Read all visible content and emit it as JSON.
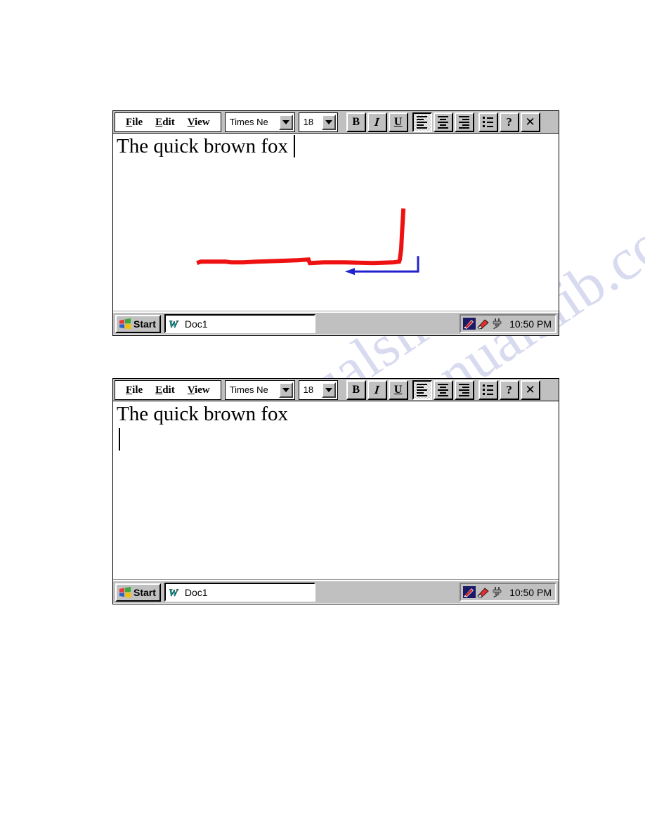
{
  "page": {
    "watermark_lines": [
      "manualslib.com",
      "manualslib.com"
    ]
  },
  "shared": {
    "menu": [
      {
        "accel": "F",
        "rest": "ile",
        "name": "file"
      },
      {
        "accel": "E",
        "rest": "dit",
        "name": "edit"
      },
      {
        "accel": "V",
        "rest": "iew",
        "name": "view"
      }
    ],
    "font_combo": {
      "value": "Times Ne",
      "options": [
        "Times Ne"
      ]
    },
    "size_combo": {
      "value": "18",
      "options": [
        "18"
      ]
    },
    "buttons": {
      "bold": "B",
      "italic": "I",
      "underline": "U",
      "align_left": "align-left-icon",
      "align_center": "align-center-icon",
      "align_right": "align-right-icon",
      "bullets": "bullet-list-icon",
      "help": "?",
      "close": "✕"
    },
    "taskbar": {
      "start_label": "Start",
      "task_label": "Doc1",
      "task_icon": "word-w-icon",
      "tray_icons": [
        "pen-input-panel-icon",
        "volume-speaker-icon",
        "power-plug-icon"
      ],
      "clock": "10:50 PM"
    }
  },
  "window_1": {
    "document_text": "The quick brown fox",
    "caret_after_text": true,
    "second_line": "",
    "ink": {
      "red_stroke_color": "#ee1111",
      "blue_arrow_color": "#2222cc",
      "description": "red L-shaped pen stroke and blue left-pointing arrow"
    }
  },
  "window_2": {
    "document_text": "The quick brown fox",
    "caret_after_text": false,
    "second_line_caret": true
  }
}
